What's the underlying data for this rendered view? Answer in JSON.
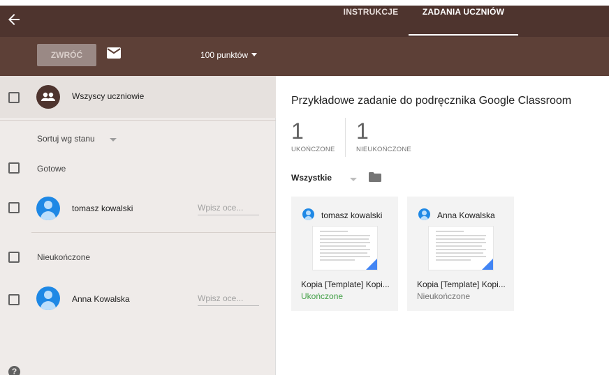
{
  "header": {
    "back_icon": "arrow-back-icon",
    "tabs": [
      {
        "label": "INSTRUKCJE",
        "active": false
      },
      {
        "label": "ZADANIA UCZNIÓW",
        "active": true
      }
    ]
  },
  "toolbar": {
    "return_label": "ZWRÓĆ",
    "mail_icon": "envelope-icon",
    "points_label": "100 punktów"
  },
  "sidebar": {
    "all_students": "Wszyscy uczniowie",
    "sort_label": "Sortuj wg stanu",
    "groups": [
      {
        "label": "Gotowe",
        "students": [
          {
            "name": "tomasz kowalski",
            "grade_placeholder": "Wpisz oce..."
          }
        ]
      },
      {
        "label": "Nieukończone",
        "students": [
          {
            "name": "Anna Kowalska",
            "grade_placeholder": "Wpisz oce..."
          }
        ]
      }
    ],
    "help_label": "?"
  },
  "main": {
    "title": "Przykładowe zadanie do podręcznika Google Classroom",
    "stats": [
      {
        "value": "1",
        "label": "UKOŃCZONE"
      },
      {
        "value": "1",
        "label": "NIEUKOŃCZONE"
      }
    ],
    "filter_label": "Wszystkie",
    "cards": [
      {
        "student": "tomasz kowalski",
        "file": "Kopia [Template] Kopi...",
        "status": "Ukończone",
        "status_color": "#43a047"
      },
      {
        "student": "Anna Kowalska",
        "file": "Kopia [Template] Kopi...",
        "status": "Nieukończone",
        "status_color": "#757575"
      }
    ]
  },
  "colors": {
    "header_bg": "#4e342e",
    "toolbar_bg": "#5d4037",
    "sidebar_bg": "#efebe9",
    "accent_blue": "#1e88e5",
    "done_green": "#43a047"
  }
}
